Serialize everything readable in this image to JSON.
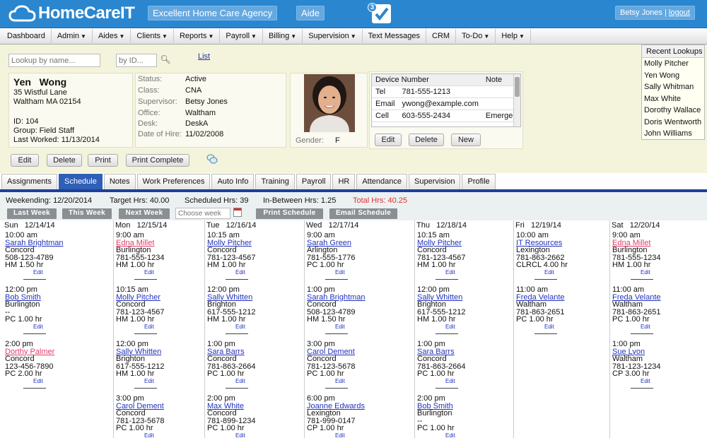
{
  "header": {
    "logo_text": "HomeCareIT",
    "agency": "Excellent Home Care Agency",
    "aide": "Aide",
    "notification_count": "3",
    "user_name": "Betsy Jones",
    "separator": "|",
    "logout": "logout"
  },
  "menu": [
    "Dashboard",
    "Admin",
    "Aides",
    "Clients",
    "Reports",
    "Payroll",
    "Billing",
    "Supervision",
    "Text Messages",
    "CRM",
    "To-Do",
    "Help"
  ],
  "menu_dropdown": [
    false,
    true,
    true,
    true,
    true,
    true,
    true,
    true,
    false,
    false,
    true,
    true
  ],
  "lookup": {
    "name_placeholder": "Lookup by name...",
    "id_placeholder": "by ID...",
    "list_link": "List"
  },
  "profile": {
    "first_name": "Yen",
    "last_name": "Wong",
    "address1": "35 Wistful Lane",
    "address2": "Waltham  MA  02154",
    "id": "ID: 104",
    "group": "Group: Field Staff",
    "last_worked": "Last Worked: 11/13/2014",
    "status_label": "Status:",
    "status": "Active",
    "class_label": "Class:",
    "class": "CNA",
    "supervisor_label": "Supervisor:",
    "supervisor": "Betsy Jones",
    "office_label": "Office:",
    "office": "Waltham",
    "desk_label": "Desk:",
    "desk": "DeskA",
    "hire_label": "Date of Hire:",
    "hire_date": "11/02/2008",
    "gender_label": "Gender:",
    "gender": "F"
  },
  "profile_buttons": {
    "edit": "Edit",
    "delete": "Delete",
    "print": "Print",
    "print_complete": "Print Complete"
  },
  "devices": {
    "header": [
      "Device Number",
      "Note"
    ],
    "rows": [
      [
        "Tel",
        "781-555-1213",
        ""
      ],
      [
        "Email",
        "ywong@example.com",
        ""
      ],
      [
        "Cell",
        "603-555-2434",
        "Emergenc"
      ]
    ]
  },
  "device_buttons": {
    "edit": "Edit",
    "delete": "Delete",
    "new": "New"
  },
  "recent": {
    "title": "Recent Lookups",
    "items": [
      "Molly Pitcher",
      "Yen Wong",
      "Sally Whitman",
      "Max White",
      "Dorothy Wallace",
      "Doris Wentworth",
      "John Williams"
    ]
  },
  "tabs": [
    "Assignments",
    "Schedule",
    "Notes",
    "Work Preferences",
    "Auto Info",
    "Training",
    "Payroll",
    "HR",
    "Attendance",
    "Supervision",
    "Profile"
  ],
  "week": {
    "weekending": "Weekending: 12/20/2014",
    "target": "Target Hrs: 40.00",
    "scheduled": "Scheduled Hrs: 39",
    "between": "In-Between Hrs: 1.25",
    "total": "Total Hrs: 40.25",
    "last_week": "Last Week",
    "this_week": "This Week",
    "next_week": "Next Week",
    "choose_placeholder": "Choose week",
    "print_schedule": "Print Schedule",
    "email_schedule": "Email Schedule"
  },
  "colors": {
    "header_bg": "#2a86cf",
    "active_tab": "#2f5fb8",
    "total_hrs": "#e03030",
    "link": "#2233bb",
    "alert_link": "#dd3f6a"
  },
  "edit_label": "Edit",
  "days": [
    {
      "dow": "Sun",
      "date": "12/14/14",
      "appts": [
        {
          "time": "10:00 am",
          "client": "Sarah Brightman",
          "city": "Concord",
          "phone": "508-123-4789",
          "hrs": "HM 1.50 hr",
          "alert": false
        },
        {
          "time": "12:00 pm",
          "client": "Bob Smith",
          "city": "Burlington",
          "phone": "--",
          "hrs": "PC 1.00 hr",
          "alert": false
        },
        {
          "time": "2:00 pm",
          "client": "Dorthy Palmer",
          "city": "Concord",
          "phone": "123-456-7890",
          "hrs": "PC 2.00 hr",
          "alert": true
        }
      ]
    },
    {
      "dow": "Mon",
      "date": "12/15/14",
      "appts": [
        {
          "time": "9:00 am",
          "client": "Edna Millet",
          "city": "Burlington",
          "phone": "781-555-1234",
          "hrs": "HM 1.00 hr",
          "alert": true
        },
        {
          "time": "10:15 am",
          "client": "Molly Pitcher",
          "city": "Concord",
          "phone": "781-123-4567",
          "hrs": "HM 1.00 hr",
          "alert": false
        },
        {
          "time": "12:00 pm",
          "client": "Sally Whitten",
          "city": "Brighton",
          "phone": "617-555-1212",
          "hrs": "HM 1.00 hr",
          "alert": false
        },
        {
          "time": "3:00 pm",
          "client": "Carol Dement",
          "city": "Concord",
          "phone": "781-123-5678",
          "hrs": "PC 1.00 hr",
          "alert": false
        }
      ]
    },
    {
      "dow": "Tue",
      "date": "12/16/14",
      "appts": [
        {
          "time": "10:15 am",
          "client": "Molly Pitcher",
          "city": "Concord",
          "phone": "781-123-4567",
          "hrs": "HM 1.00 hr",
          "alert": false
        },
        {
          "time": "12:00 pm",
          "client": "Sally Whitten",
          "city": "Brighton",
          "phone": "617-555-1212",
          "hrs": "HM 1.00 hr",
          "alert": false
        },
        {
          "time": "1:00 pm",
          "client": "Sara Barrs",
          "city": "Concord",
          "phone": "781-863-2664",
          "hrs": "PC 1.00 hr",
          "alert": false
        },
        {
          "time": "2:00 pm",
          "client": "Max White",
          "city": "Concord",
          "phone": "781-899-1234",
          "hrs": "PC 1.00 hr",
          "alert": false
        }
      ]
    },
    {
      "dow": "Wed",
      "date": "12/17/14",
      "appts": [
        {
          "time": "9:00 am",
          "client": "Sarah Green",
          "city": "Arlington",
          "phone": "781-555-1776",
          "hrs": "PC 1.00 hr",
          "alert": false
        },
        {
          "time": "1:00 pm",
          "client": "Sarah Brightman",
          "city": "Concord",
          "phone": "508-123-4789",
          "hrs": "HM 1.50 hr",
          "alert": false
        },
        {
          "time": "3:00 pm",
          "client": "Carol Dement",
          "city": "Concord",
          "phone": "781-123-5678",
          "hrs": "PC 1.00 hr",
          "alert": false
        },
        {
          "time": "6:00 pm",
          "client": "Joanne Edwards",
          "city": "Lexington",
          "phone": "781-999-0147",
          "hrs": "CP 1.00 hr",
          "alert": false
        }
      ]
    },
    {
      "dow": "Thu",
      "date": "12/18/14",
      "appts": [
        {
          "time": "10:15 am",
          "client": "Molly Pitcher",
          "city": "Concord",
          "phone": "781-123-4567",
          "hrs": "HM 1.00 hr",
          "alert": false
        },
        {
          "time": "12:00 pm",
          "client": "Sally Whitten",
          "city": "Brighton",
          "phone": "617-555-1212",
          "hrs": "HM 1.00 hr",
          "alert": false
        },
        {
          "time": "1:00 pm",
          "client": "Sara Barrs",
          "city": "Concord",
          "phone": "781-863-2664",
          "hrs": "PC 1.00 hr",
          "alert": false
        },
        {
          "time": "2:00 pm",
          "client": "Bob Smith",
          "city": "Burlington",
          "phone": "--",
          "hrs": "PC 1.00 hr",
          "alert": false
        }
      ]
    },
    {
      "dow": "Fri",
      "date": "12/19/14",
      "appts": [
        {
          "time": "10:00 am",
          "client": "IT Resources",
          "city": "Lexington",
          "phone": "781-863-2662",
          "hrs": "CLRCL 4.00 hr",
          "alert": false
        },
        {
          "time": "11:00 am",
          "client": "Freda Velante",
          "city": "Waltham",
          "phone": "781-863-2651",
          "hrs": "PC 1.00 hr",
          "alert": false
        }
      ]
    },
    {
      "dow": "Sat",
      "date": "12/20/14",
      "appts": [
        {
          "time": "9:00 am",
          "client": "Edna Millet",
          "city": "Burlington",
          "phone": "781-555-1234",
          "hrs": "HM 1.00 hr",
          "alert": true
        },
        {
          "time": "11:00 am",
          "client": "Freda Velante",
          "city": "Waltham",
          "phone": "781-863-2651",
          "hrs": "PC 1.00 hr",
          "alert": false
        },
        {
          "time": "1:00 pm",
          "client": "Sue Lyon",
          "city": "Waltham",
          "phone": "781-123-1234",
          "hrs": "CP 3.00 hr",
          "alert": false
        }
      ]
    }
  ]
}
